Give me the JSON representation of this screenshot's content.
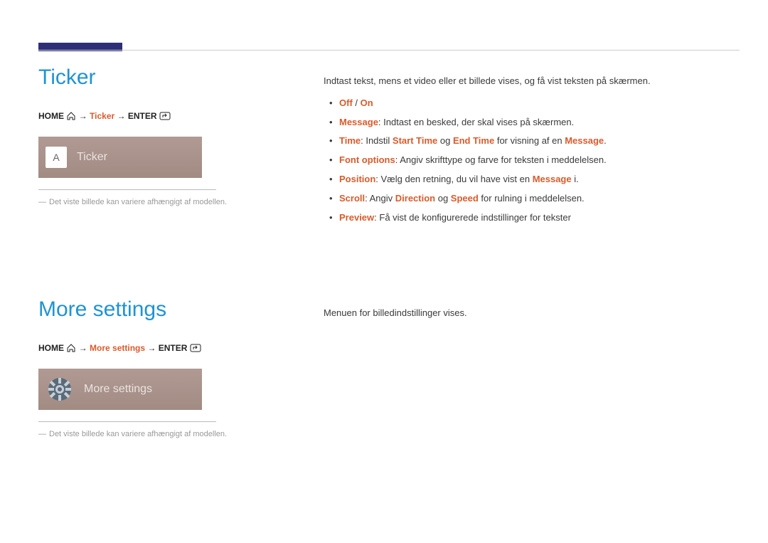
{
  "section1": {
    "title": "Ticker",
    "breadcrumb": {
      "home": "HOME",
      "highlight": "Ticker",
      "enter": "ENTER"
    },
    "ui": {
      "badge": "A",
      "label": "Ticker"
    },
    "caption": "Det viste billede kan variere afhængigt af modellen.",
    "intro": "Indtast tekst, mens et video eller et billede vises, og få vist teksten på skærmen.",
    "bullets": {
      "b1": {
        "off": "Off",
        "slash": " / ",
        "on": "On"
      },
      "b2": {
        "k": "Message",
        "rest": ": Indtast en besked, der skal vises på skærmen."
      },
      "b3": {
        "k": "Time",
        "p1": ": Indstil ",
        "k2": "Start Time",
        "p2": " og ",
        "k3": "End Time",
        "p3": " for visning af en ",
        "k4": "Message",
        "p4": "."
      },
      "b4": {
        "k": "Font options",
        "rest": ": Angiv skrifttype og farve for teksten i meddelelsen."
      },
      "b5": {
        "k": "Position",
        "p1": ":  Vælg den retning, du vil have vist en ",
        "k2": "Message",
        "p2": " i."
      },
      "b6": {
        "k": "Scroll",
        "p1": ": Angiv ",
        "k2": "Direction",
        "p2": " og ",
        "k3": "Speed",
        "p3": " for rulning i meddelelsen."
      },
      "b7": {
        "k": "Preview",
        "rest": ": Få vist de konfigurerede indstillinger for tekster"
      }
    }
  },
  "section2": {
    "title": "More settings",
    "breadcrumb": {
      "home": "HOME",
      "highlight": "More settings",
      "enter": "ENTER"
    },
    "ui": {
      "label": "More settings"
    },
    "caption": "Det viste billede kan variere afhængigt af modellen.",
    "intro": "Menuen for billedindstillinger vises."
  }
}
